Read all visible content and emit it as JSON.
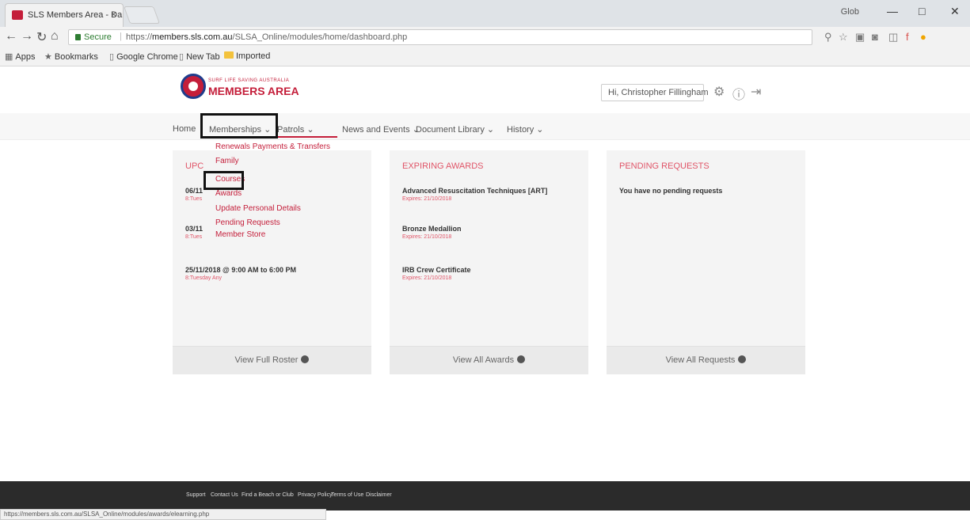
{
  "browser": {
    "tab_title": "SLS Members Area - Da",
    "tab_close": "×",
    "user_label": "Glob",
    "win_min": "—",
    "win_max": "□",
    "win_close": "✕",
    "secure_label": "Secure",
    "url_prefix": "https://",
    "url_domain": "members.sls.com.au",
    "url_path": "/SLSA_Online/modules/home/dashboard.php",
    "status_url": "https://members.sls.com.au/SLSA_Online/modules/awards/elearning.php"
  },
  "bookmarks": {
    "apps": "Apps",
    "bookmarks": "Bookmarks",
    "chrome": "Google Chrome",
    "new_tab": "New Tab",
    "imported": "Imported"
  },
  "header": {
    "logo_sub": "SURF LIFE SAVING AUSTRALIA",
    "logo_main": "MEMBERS AREA",
    "greeting": "Hi, Christopher Fillingham"
  },
  "nav": {
    "home": "Home",
    "memberships": "Memberships",
    "patrols": "Patrols",
    "news": "News and Events",
    "documents": "Document Library",
    "history": "History"
  },
  "dropdown": {
    "renewals": "Renewals Payments & Transfers",
    "family": "Family",
    "courses": "Courses",
    "awards": "Awards",
    "update": "Update Personal Details",
    "pending": "Pending Requests",
    "store": "Member Store"
  },
  "upcoming": {
    "title": "UPC",
    "events": [
      {
        "date": "06/11",
        "sub": "8:Tues"
      },
      {
        "date": "03/11",
        "sub": "8:Tues"
      },
      {
        "date": "25/11/2018 @ 9:00 AM to 6:00 PM",
        "sub": "8:Tuesday Any"
      }
    ],
    "footer": "View Full Roster"
  },
  "awards": {
    "title": "EXPIRING AWARDS",
    "items": [
      {
        "name": "Advanced Resuscitation Techniques [ART]",
        "sub": "Expires: 21/10/2018"
      },
      {
        "name": "Bronze Medallion",
        "sub": "Expires: 21/10/2018"
      },
      {
        "name": "IRB Crew Certificate",
        "sub": "Expires: 21/10/2018"
      }
    ],
    "footer": "View All Awards"
  },
  "requests": {
    "title": "PENDING REQUESTS",
    "empty": "You have no pending requests",
    "footer": "View All Requests"
  },
  "footer": {
    "support": "Support",
    "contact": "Contact Us",
    "find": "Find a Beach or Club",
    "privacy": "Privacy Policy",
    "terms": "Terms of Use",
    "disclaimer": "Disclaimer"
  },
  "colors": {
    "accent": "#c41e3a",
    "title": "#e05467",
    "footer": "#2b2b2b"
  }
}
